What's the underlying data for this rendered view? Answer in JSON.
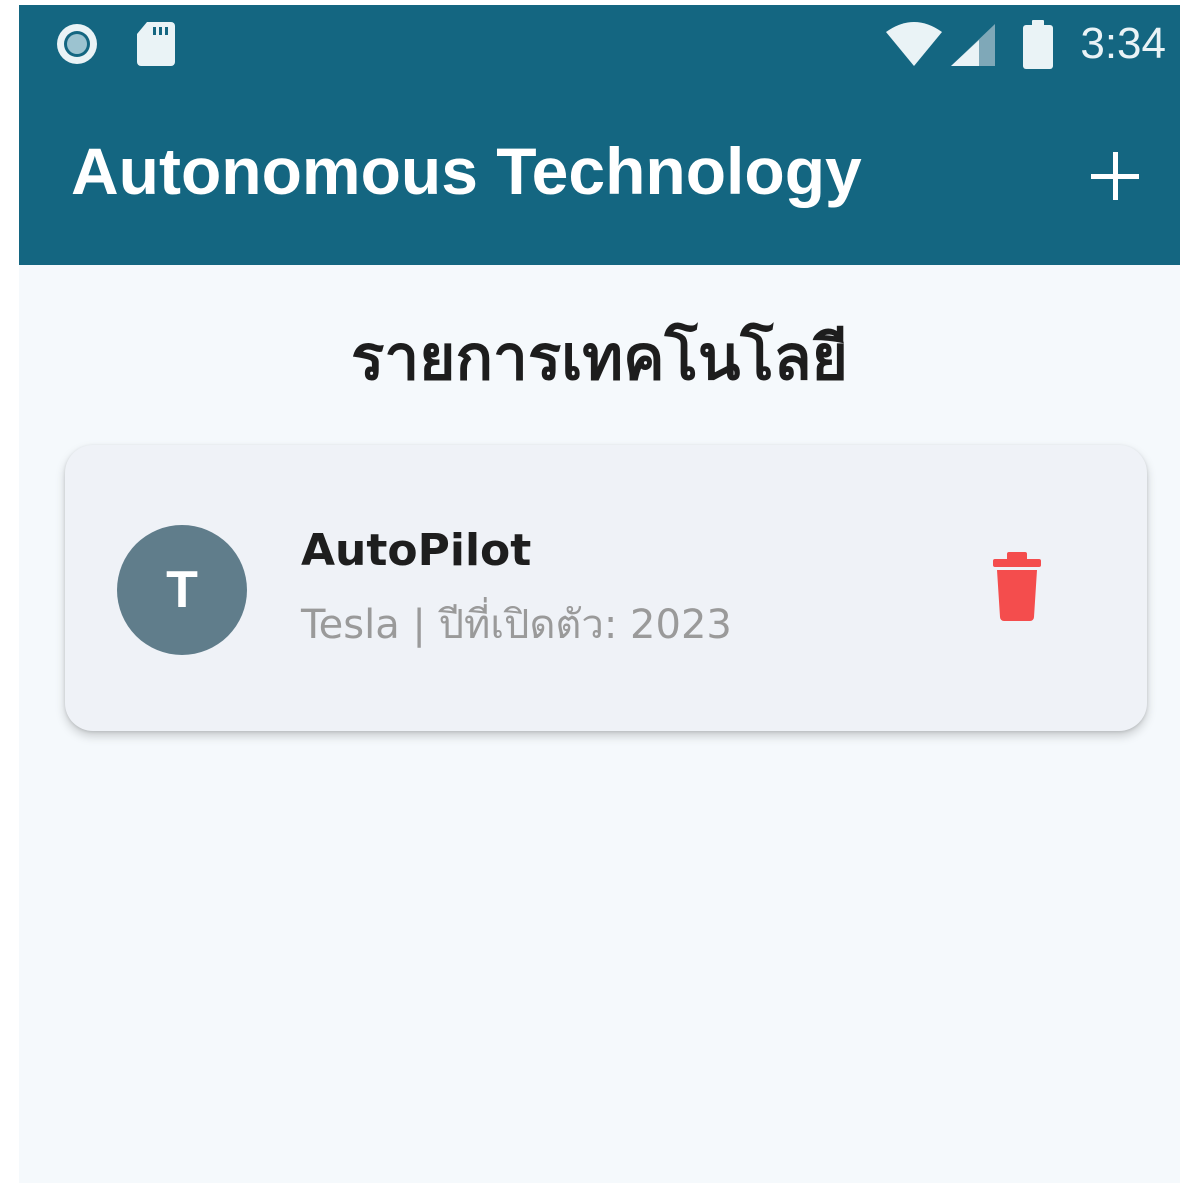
{
  "status_bar": {
    "time": "3:34",
    "icons": [
      "record-icon",
      "sd-card-icon",
      "wifi-icon",
      "cell-signal-icon",
      "battery-icon"
    ]
  },
  "app_bar": {
    "title": "Autonomous Technology",
    "add_icon": "plus-icon"
  },
  "main": {
    "section_title": "รายการเทคโนโลยี",
    "items": [
      {
        "avatar_letter": "T",
        "name": "AutoPilot",
        "subtitle": "Tesla | ปีที่เปิดตัว: 2023",
        "delete_icon": "trash-icon"
      }
    ]
  },
  "colors": {
    "primary": "#146681",
    "background": "#f5f9fc",
    "card": "#eff2f7",
    "avatar": "#607d8b",
    "delete": "#f44d4d"
  }
}
